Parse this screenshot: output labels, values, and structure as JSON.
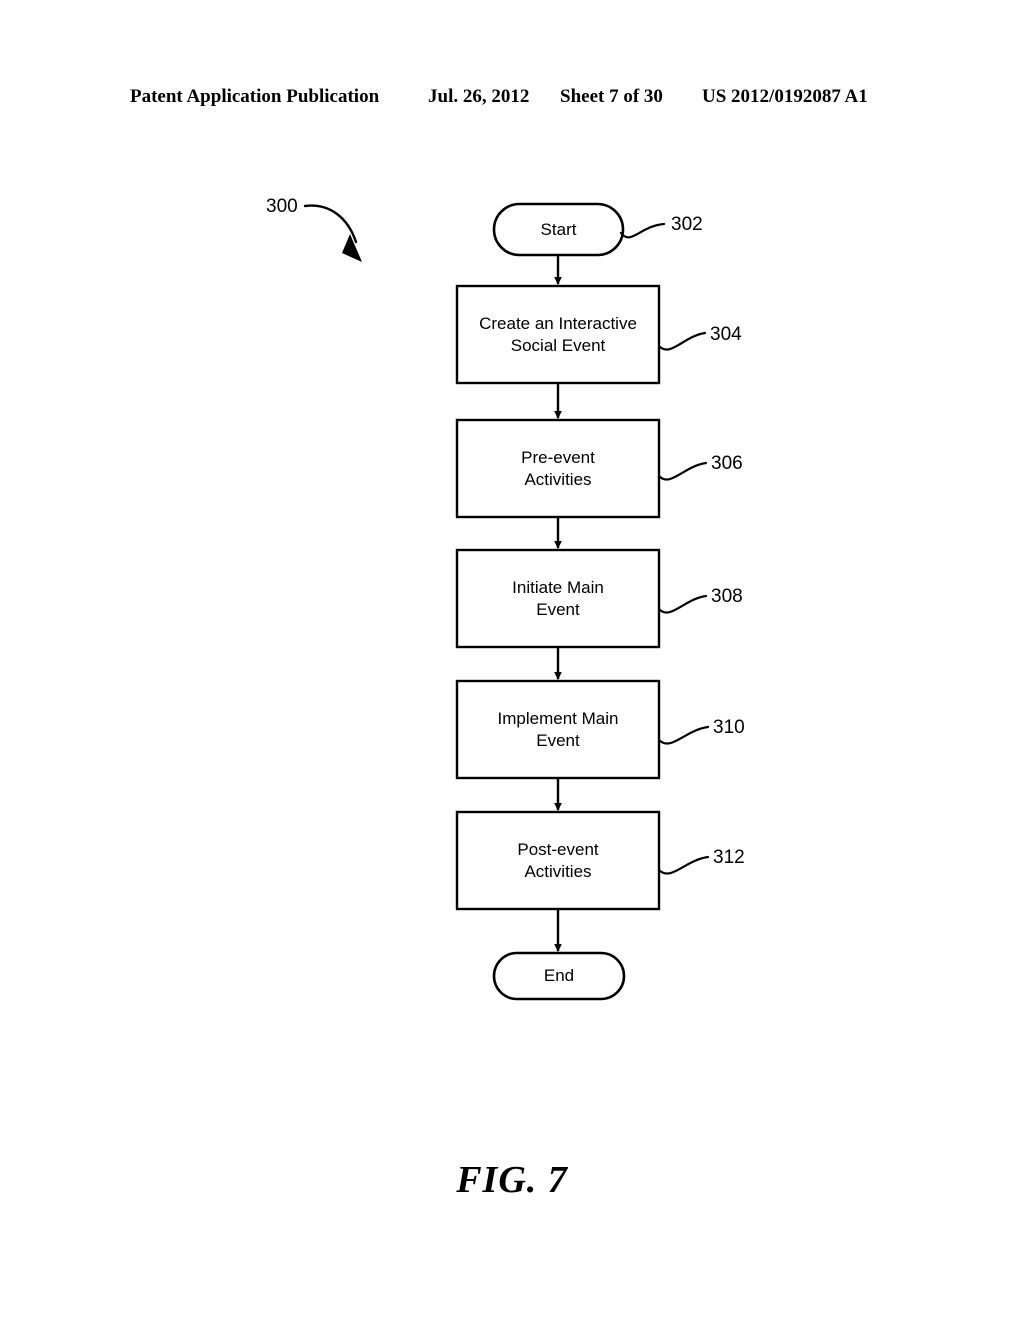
{
  "header": {
    "title": "Patent Application Publication",
    "date": "Jul. 26, 2012",
    "sheet": "Sheet 7 of 30",
    "publication_number": "US 2012/0192087 A1"
  },
  "figure": {
    "caption": "FIG. 7",
    "diagram_numeral": "300",
    "nodes": [
      {
        "id": "302",
        "type": "terminal",
        "label": "Start",
        "ref": "302"
      },
      {
        "id": "304",
        "type": "process",
        "label": "Create an Interactive\nSocial Event",
        "ref": "304"
      },
      {
        "id": "306",
        "type": "process",
        "label": "Pre-event\nActivities",
        "ref": "306"
      },
      {
        "id": "308",
        "type": "process",
        "label": "Initiate Main\nEvent",
        "ref": "308"
      },
      {
        "id": "310",
        "type": "process",
        "label": "Implement Main\nEvent",
        "ref": "310"
      },
      {
        "id": "312",
        "type": "process",
        "label": "Post-event\nActivities",
        "ref": "312"
      },
      {
        "id": "end",
        "type": "terminal",
        "label": "End",
        "ref": ""
      }
    ]
  },
  "colors": {
    "page_background": "#ffffff",
    "ink": "#000000"
  }
}
